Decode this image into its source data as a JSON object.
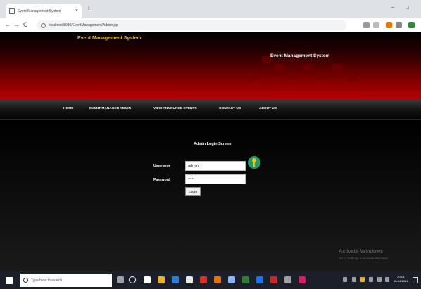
{
  "browser": {
    "tab_title": "Event Management System",
    "tab_close": "×",
    "new_tab": "+",
    "minimize": "–",
    "maximize": "□",
    "url": "localhost:8080/EventManagement/Admin.jsp",
    "back": "←",
    "forward": "→",
    "reload": "C"
  },
  "header": {
    "title": "Event Management System",
    "subtitle": "Event Management System"
  },
  "nav": {
    "items": [
      "HOME",
      "EVENT MANAGER ADMIN",
      "VIEW ANNOUNCE EVENTS",
      "CONTACT US",
      "ABOUT US"
    ]
  },
  "login": {
    "title": "Admin Login Screen",
    "username_label": "Username",
    "username_value": "admin",
    "password_label": "Password",
    "password_value": "•••••",
    "button_label": "Login"
  },
  "watermark": {
    "title": "Activate Windows",
    "subtitle": "Go to Settings to activate Windows."
  },
  "taskbar": {
    "search_placeholder": "Type here to search",
    "time": "20:15",
    "date": "15-04-2021"
  },
  "colors": {
    "header_gold": "#f0c000",
    "header_red": "#b80000",
    "key_green": "#1e9a6e"
  }
}
